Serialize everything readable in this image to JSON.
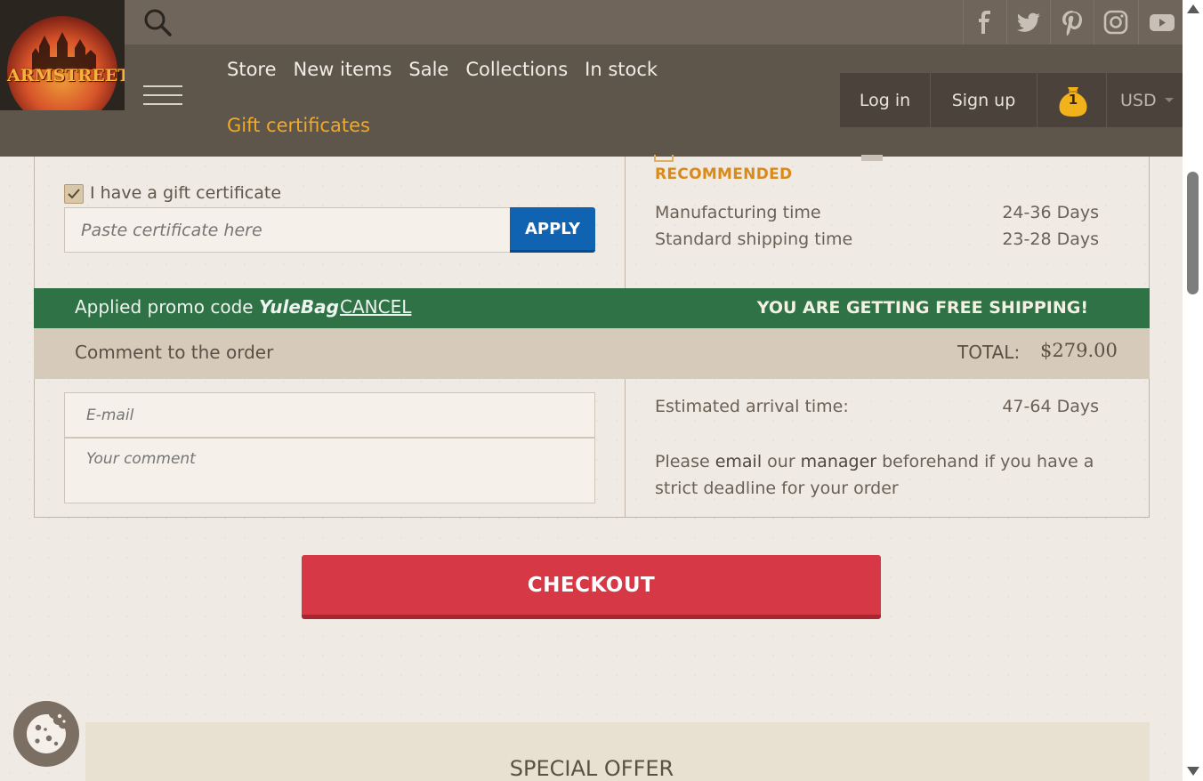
{
  "brand": {
    "logo_text": "ARMSTREET"
  },
  "social": [
    {
      "name": "facebook-icon"
    },
    {
      "name": "twitter-icon"
    },
    {
      "name": "pinterest-icon"
    },
    {
      "name": "instagram-icon"
    },
    {
      "name": "youtube-icon"
    }
  ],
  "nav": {
    "items": [
      "Store",
      "New items",
      "Sale",
      "Collections",
      "In stock"
    ],
    "gift_certificates": "Gift certificates"
  },
  "account": {
    "login": "Log in",
    "signup": "Sign up",
    "cart_count": "1",
    "currency": "USD"
  },
  "shipping": {
    "recommended": "RECOMMENDED",
    "manufacturing_label": "Manufacturing time",
    "manufacturing_value": "24-36 Days",
    "standard_label": "Standard shipping time",
    "standard_value": "23-28 Days"
  },
  "gift_certificate": {
    "checkbox_label": "I have a gift certificate",
    "checked": true,
    "placeholder": "Paste certificate here",
    "apply_label": "APPLY"
  },
  "promo": {
    "prefix": "Applied promo code ",
    "code": "YuleBag",
    "cancel": "CANCEL",
    "free_shipping": "YOU ARE GETTING FREE SHIPPING!"
  },
  "order": {
    "comment_title": "Comment to the order",
    "total_label": "TOTAL:",
    "total_value": "$279.00",
    "email_placeholder": "E-mail",
    "comment_placeholder": "Your comment",
    "arrival_label": "Estimated arrival time:",
    "arrival_value": "47-64 Days",
    "deadline_pre": "Please ",
    "deadline_email": "email",
    "deadline_mid": " our ",
    "deadline_manager": "manager",
    "deadline_post": " beforehand if you have a strict deadline for your order"
  },
  "checkout_label": "CHECKOUT",
  "special_offer": "SPECIAL OFFER",
  "colors": {
    "header_top": "#6f655a",
    "header_nav": "#5e554b",
    "accent_gold": "#f2a924",
    "apply_blue": "#0f63b0",
    "promo_green": "#2e7245",
    "checkout_red": "#d63846"
  }
}
